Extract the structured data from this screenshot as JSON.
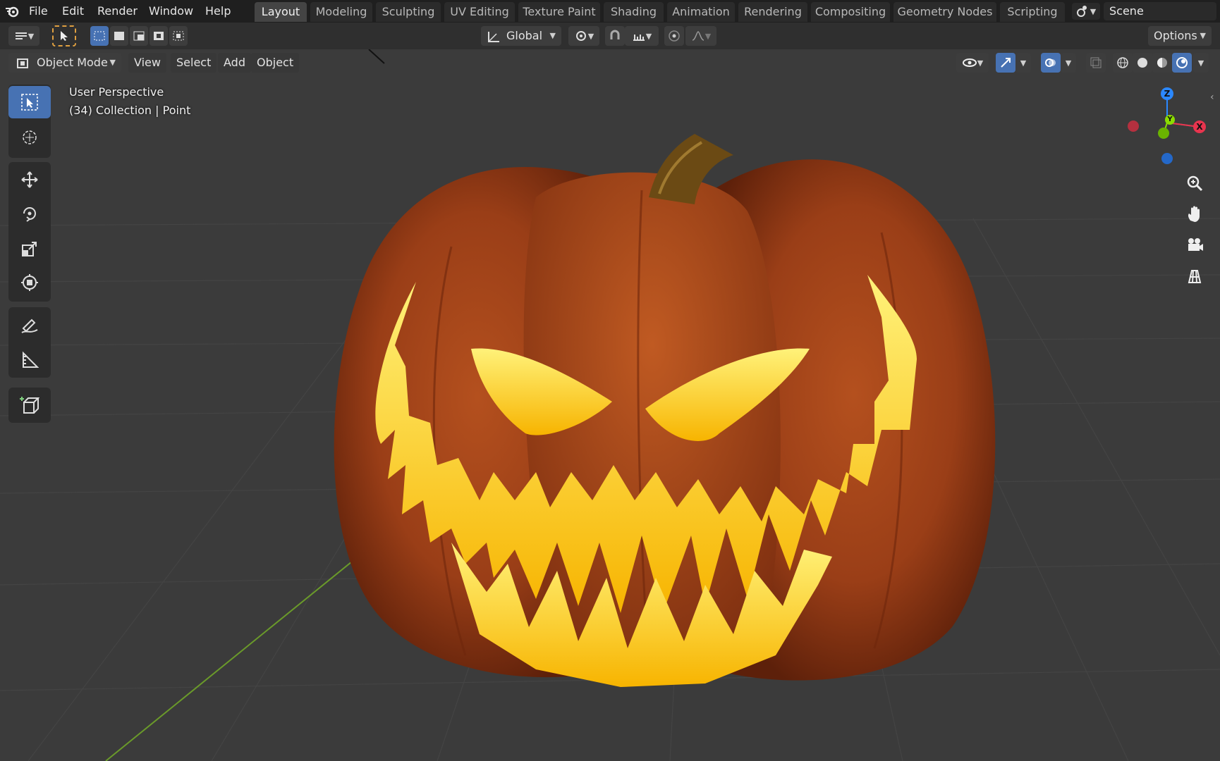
{
  "menu": {
    "items": [
      "File",
      "Edit",
      "Render",
      "Window",
      "Help"
    ]
  },
  "workspace_tabs": [
    "Layout",
    "Modeling",
    "Sculpting",
    "UV Editing",
    "Texture Paint",
    "Shading",
    "Animation",
    "Rendering",
    "Compositing",
    "Geometry Nodes",
    "Scripting"
  ],
  "active_tab": "Layout",
  "scene": {
    "name": "Scene"
  },
  "tool_header": {
    "orientation": "Global",
    "options_label": "Options"
  },
  "viewport_header": {
    "mode": "Object Mode",
    "menus": [
      "View",
      "Select",
      "Add",
      "Object"
    ]
  },
  "viewport": {
    "perspective_label": "User Perspective",
    "collection_label": "(34) Collection | Point"
  },
  "gizmo": {
    "x_label": "X",
    "y_label": "Y",
    "z_label": "Z",
    "x_color": "#e8344e",
    "y_color": "#8bdc00",
    "z_color": "#2b88ff"
  },
  "toolbar_icons": [
    "select-box",
    "cursor",
    "move",
    "rotate",
    "scale",
    "transform",
    "annotate",
    "measure",
    "add-cube"
  ],
  "nav_icons": [
    "zoom",
    "pan",
    "camera",
    "ortho-grid"
  ],
  "colors": {
    "accent": "#4772b3",
    "background": "#3a3a3a"
  }
}
